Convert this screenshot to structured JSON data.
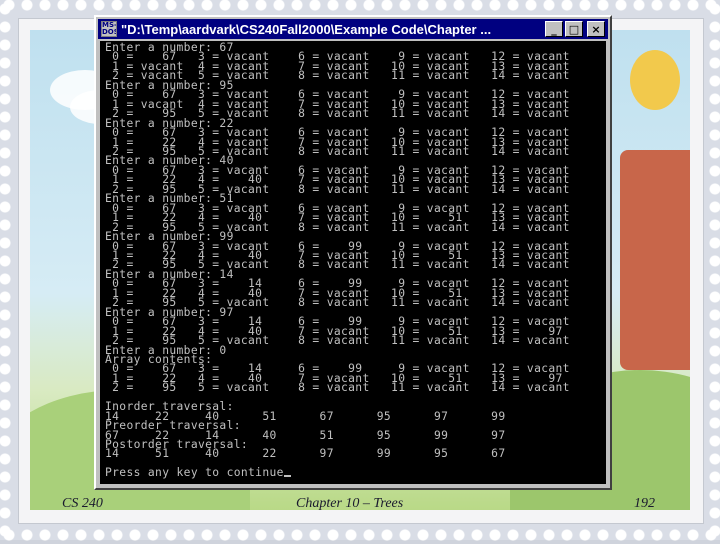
{
  "window": {
    "title": "\"D:\\Temp\\aardvark\\CS240Fall2000\\Example Code\\Chapter ...",
    "icon_label": "MS-DOS",
    "buttons": {
      "minimize": "_",
      "maximize": "□",
      "close": "×"
    }
  },
  "console": {
    "lines": [
      "Enter a number: 67",
      " 0 =    67   3 = vacant    6 = vacant    9 = vacant   12 = vacant",
      " 1 = vacant  4 = vacant    7 = vacant   10 = vacant   13 = vacant",
      " 2 = vacant  5 = vacant    8 = vacant   11 = vacant   14 = vacant",
      "Enter a number: 95",
      " 0 =    67   3 = vacant    6 = vacant    9 = vacant   12 = vacant",
      " 1 = vacant  4 = vacant    7 = vacant   10 = vacant   13 = vacant",
      " 2 =    95   5 = vacant    8 = vacant   11 = vacant   14 = vacant",
      "Enter a number: 22",
      " 0 =    67   3 = vacant    6 = vacant    9 = vacant   12 = vacant",
      " 1 =    22   4 = vacant    7 = vacant   10 = vacant   13 = vacant",
      " 2 =    95   5 = vacant    8 = vacant   11 = vacant   14 = vacant",
      "Enter a number: 40",
      " 0 =    67   3 = vacant    6 = vacant    9 = vacant   12 = vacant",
      " 1 =    22   4 =    40     7 = vacant   10 = vacant   13 = vacant",
      " 2 =    95   5 = vacant    8 = vacant   11 = vacant   14 = vacant",
      "Enter a number: 51",
      " 0 =    67   3 = vacant    6 = vacant    9 = vacant   12 = vacant",
      " 1 =    22   4 =    40     7 = vacant   10 =    51    13 = vacant",
      " 2 =    95   5 = vacant    8 = vacant   11 = vacant   14 = vacant",
      "Enter a number: 99",
      " 0 =    67   3 = vacant    6 =    99     9 = vacant   12 = vacant",
      " 1 =    22   4 =    40     7 = vacant   10 =    51    13 = vacant",
      " 2 =    95   5 = vacant    8 = vacant   11 = vacant   14 = vacant",
      "Enter a number: 14",
      " 0 =    67   3 =    14     6 =    99     9 = vacant   12 = vacant",
      " 1 =    22   4 =    40     7 = vacant   10 =    51    13 = vacant",
      " 2 =    95   5 = vacant    8 = vacant   11 = vacant   14 = vacant",
      "Enter a number: 97",
      " 0 =    67   3 =    14     6 =    99     9 = vacant   12 = vacant",
      " 1 =    22   4 =    40     7 = vacant   10 =    51    13 =    97",
      " 2 =    95   5 = vacant    8 = vacant   11 = vacant   14 = vacant",
      "Enter a number: 0",
      "Array contents:",
      " 0 =    67   3 =    14     6 =    99     9 = vacant   12 = vacant",
      " 1 =    22   4 =    40     7 = vacant   10 =    51    13 =    97",
      " 2 =    95   5 = vacant    8 = vacant   11 = vacant   14 = vacant",
      "",
      "Inorder traversal:",
      "14     22     40      51      67      95      97      99",
      "Preorder traversal:",
      "67     22     14      40      51      95      99      97",
      "Postorder traversal:",
      "14     51     40      22      97      99      95      67",
      "",
      "Press any key to continue"
    ]
  },
  "footer": {
    "course": "CS 240",
    "chapter": "Chapter 10 – Trees",
    "page": "192"
  }
}
